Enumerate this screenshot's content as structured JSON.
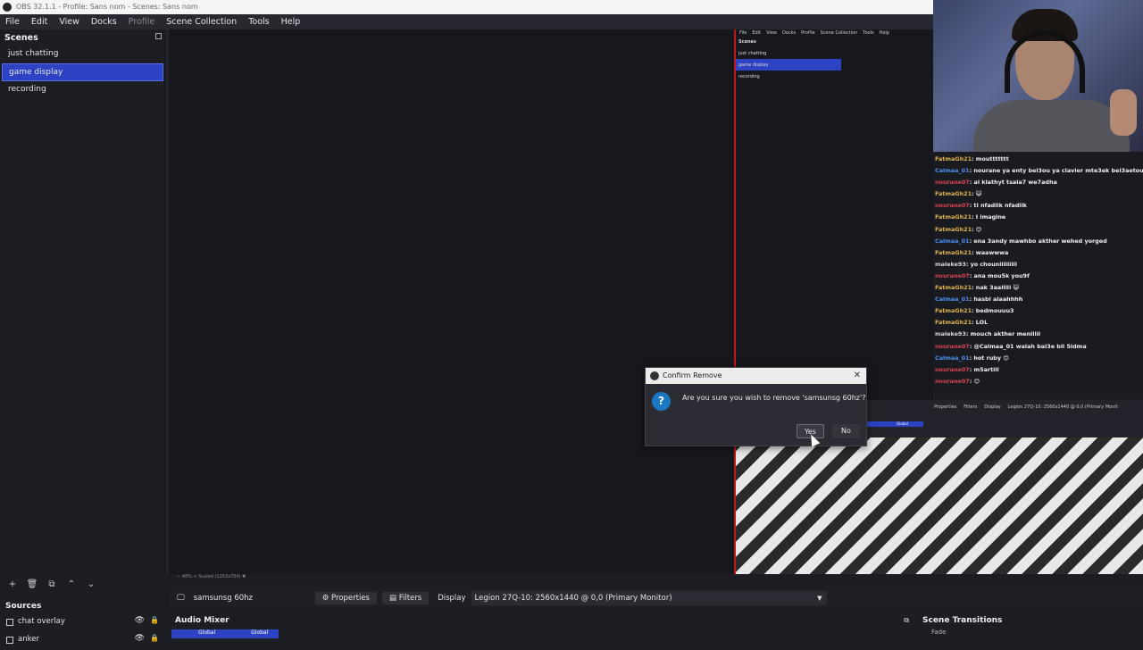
{
  "window": {
    "title": "OBS 32.1.1 - Profile: Sans nom - Scenes: Sans nom"
  },
  "menu": {
    "items": [
      "File",
      "Edit",
      "View",
      "Docks",
      "Profile",
      "Scene Collection",
      "Tools",
      "Help"
    ]
  },
  "scenes": {
    "title": "Scenes",
    "items": [
      {
        "label": "just chatting"
      },
      {
        "label": "game display"
      },
      {
        "label": "recording"
      }
    ],
    "active_index": 1
  },
  "nested": {
    "menu": [
      "File",
      "Edit",
      "View",
      "Docks",
      "Profile",
      "Scene Collection",
      "Tools",
      "Help"
    ],
    "scenes_title": "Scenes",
    "scenes": [
      "just chatting",
      "game display",
      "recording"
    ],
    "bar": [
      "Properties",
      "Filters",
      "Display",
      "Legion 27Q-10: 2560x1440 @ 0,0 (Primary Monit"
    ],
    "global": "Global"
  },
  "chat": [
    {
      "user": "FatmaGh21",
      "msg": ": mouttttttt",
      "color": "#e0b24b"
    },
    {
      "user": "Calmaa_01",
      "msg": ": nourane ya enty bel3ou ya clavier mte3ek bel3aetou",
      "color": "#4a8ff0"
    },
    {
      "user": "nourane07",
      "msg": ": al klathyt tsala7 we7adha",
      "color": "#d9434f"
    },
    {
      "user": "FatmaGh21",
      "msg": ": 😺",
      "color": "#e0b24b"
    },
    {
      "user": "nourane07",
      "msg": ": ti nfadlik nfadlik",
      "color": "#d9434f"
    },
    {
      "user": "FatmaGh21",
      "msg": ": I imagine",
      "color": "#e0b24b"
    },
    {
      "user": "FatmaGh21",
      "msg": ": 😊",
      "color": "#e0b24b"
    },
    {
      "user": "Calmaa_01",
      "msg": ": ena 3andy mawhbo akther wehed yorged",
      "color": "#4a8ff0"
    },
    {
      "user": "FatmaGh21",
      "msg": ": waawwwa",
      "color": "#e0b24b"
    },
    {
      "user": "maleke93",
      "msg": ": yo chouniiiiiiiii",
      "color": "#d7d7d7"
    },
    {
      "user": "nourane07",
      "msg": ": ana mou5k you9f",
      "color": "#d9434f"
    },
    {
      "user": "FatmaGh21",
      "msg": ": nak 3aalllll 😺",
      "color": "#e0b24b"
    },
    {
      "user": "Calmaa_01",
      "msg": ": hasbi alaahhhh",
      "color": "#4a8ff0"
    },
    {
      "user": "FatmaGh21",
      "msg": ": bedmouuu3",
      "color": "#e0b24b"
    },
    {
      "user": "FatmaGh21",
      "msg": ": LOL",
      "color": "#e0b24b"
    },
    {
      "user": "maleke93",
      "msg": ": mouch akther meniiiii",
      "color": "#d7d7d7"
    },
    {
      "user": "nourane07",
      "msg": ": @Calmaa_01 walah bal3e bil 5idma",
      "color": "#d9434f"
    },
    {
      "user": "Calmaa_01",
      "msg": ": hot ruby 😊",
      "color": "#4a8ff0"
    },
    {
      "user": "nourane07",
      "msg": ": m5artill",
      "color": "#d9434f"
    },
    {
      "user": "nourane07",
      "msg": ": 😊",
      "color": "#d9434f"
    }
  ],
  "dialog": {
    "title": "Confirm Remove",
    "message": "Are you sure you wish to remove 'samsunsg 60hz'?",
    "yes": "Yes",
    "no": "No",
    "close": "✕",
    "icon": "?"
  },
  "preview_footer": "−   48%   +   Scaled (1262x704)   ▼",
  "source_toolbar": {
    "source_name": "samsunsg 60hz",
    "properties": "Properties",
    "filters": "Filters",
    "display_label": "Display",
    "display_value": "Legion 27Q-10: 2560x1440 @ 0,0 (Primary Monitor)"
  },
  "sources": {
    "title": "Sources",
    "items": [
      {
        "label": "chat overlay"
      },
      {
        "label": "anker"
      }
    ]
  },
  "mixer": {
    "title": "Audio Mixer",
    "global": "Global"
  },
  "transitions": {
    "title": "Scene Transitions",
    "value": "Fade"
  },
  "colors": {
    "accent": "#2e43c4",
    "background": "#1d1e24",
    "redline": "#c01818"
  }
}
